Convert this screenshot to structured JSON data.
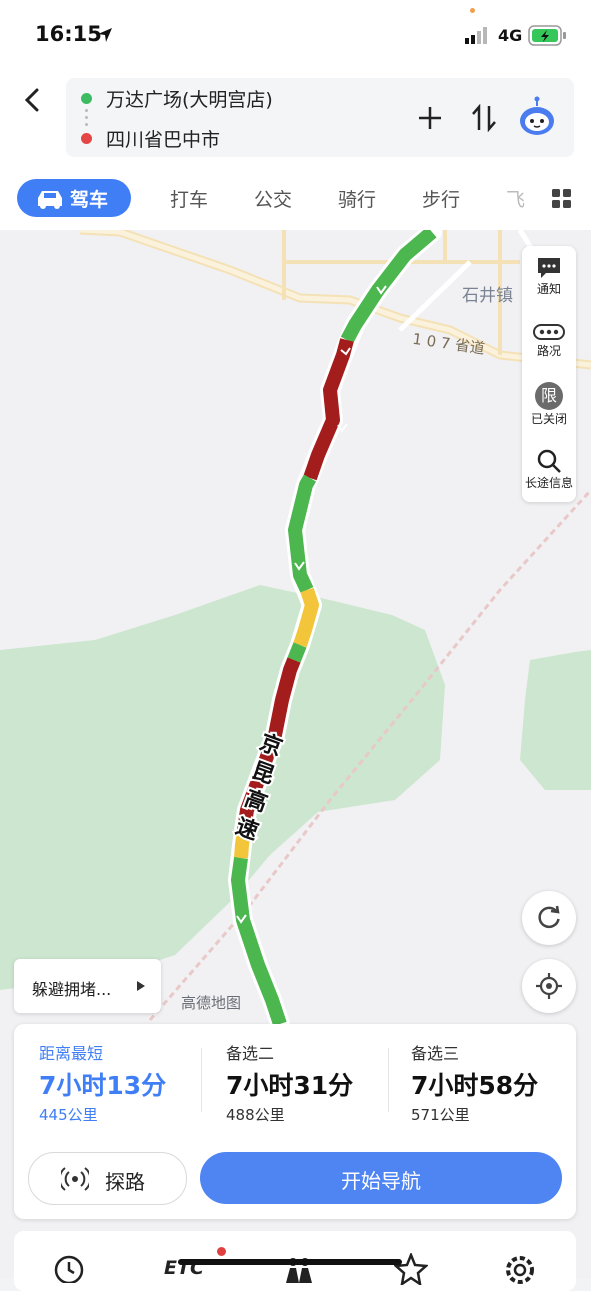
{
  "status_bar": {
    "time": "16:15",
    "network": "4G"
  },
  "route": {
    "origin": "万达广场(大明宫店)",
    "destination": "四川省巴中市"
  },
  "modes": [
    {
      "label": "驾车",
      "active": true
    },
    {
      "label": "打车"
    },
    {
      "label": "公交"
    },
    {
      "label": "骑行"
    },
    {
      "label": "步行"
    },
    {
      "label": "飞"
    }
  ],
  "map": {
    "town_label": "石井镇",
    "road_label": "1 0 7 省道",
    "highway_label_chars": [
      "京",
      "昆",
      "高",
      "速"
    ],
    "watermark": "高德地图"
  },
  "tools": [
    {
      "label": "通知",
      "icon": "message-icon"
    },
    {
      "label": "路况",
      "icon": "traffic-icon"
    },
    {
      "label": "已关闭",
      "icon": "restriction-icon",
      "glyph": "限"
    },
    {
      "label": "长途信息",
      "icon": "search-icon"
    }
  ],
  "avoid_button": {
    "label": "躲避拥堵..."
  },
  "options": [
    {
      "label": "距离最短",
      "time": "7小时13分",
      "distance": "445公里",
      "selected": true
    },
    {
      "label": "备选二",
      "time": "7小时31分",
      "distance": "488公里"
    },
    {
      "label": "备选三",
      "time": "7小时58分",
      "distance": "571公里"
    }
  ],
  "actions": {
    "probe": "探路",
    "start": "开始导航"
  },
  "colors": {
    "accent": "#3f7ef5",
    "green": "#4cb64f",
    "red": "#a31d1d",
    "yellow": "#f2c53a"
  }
}
